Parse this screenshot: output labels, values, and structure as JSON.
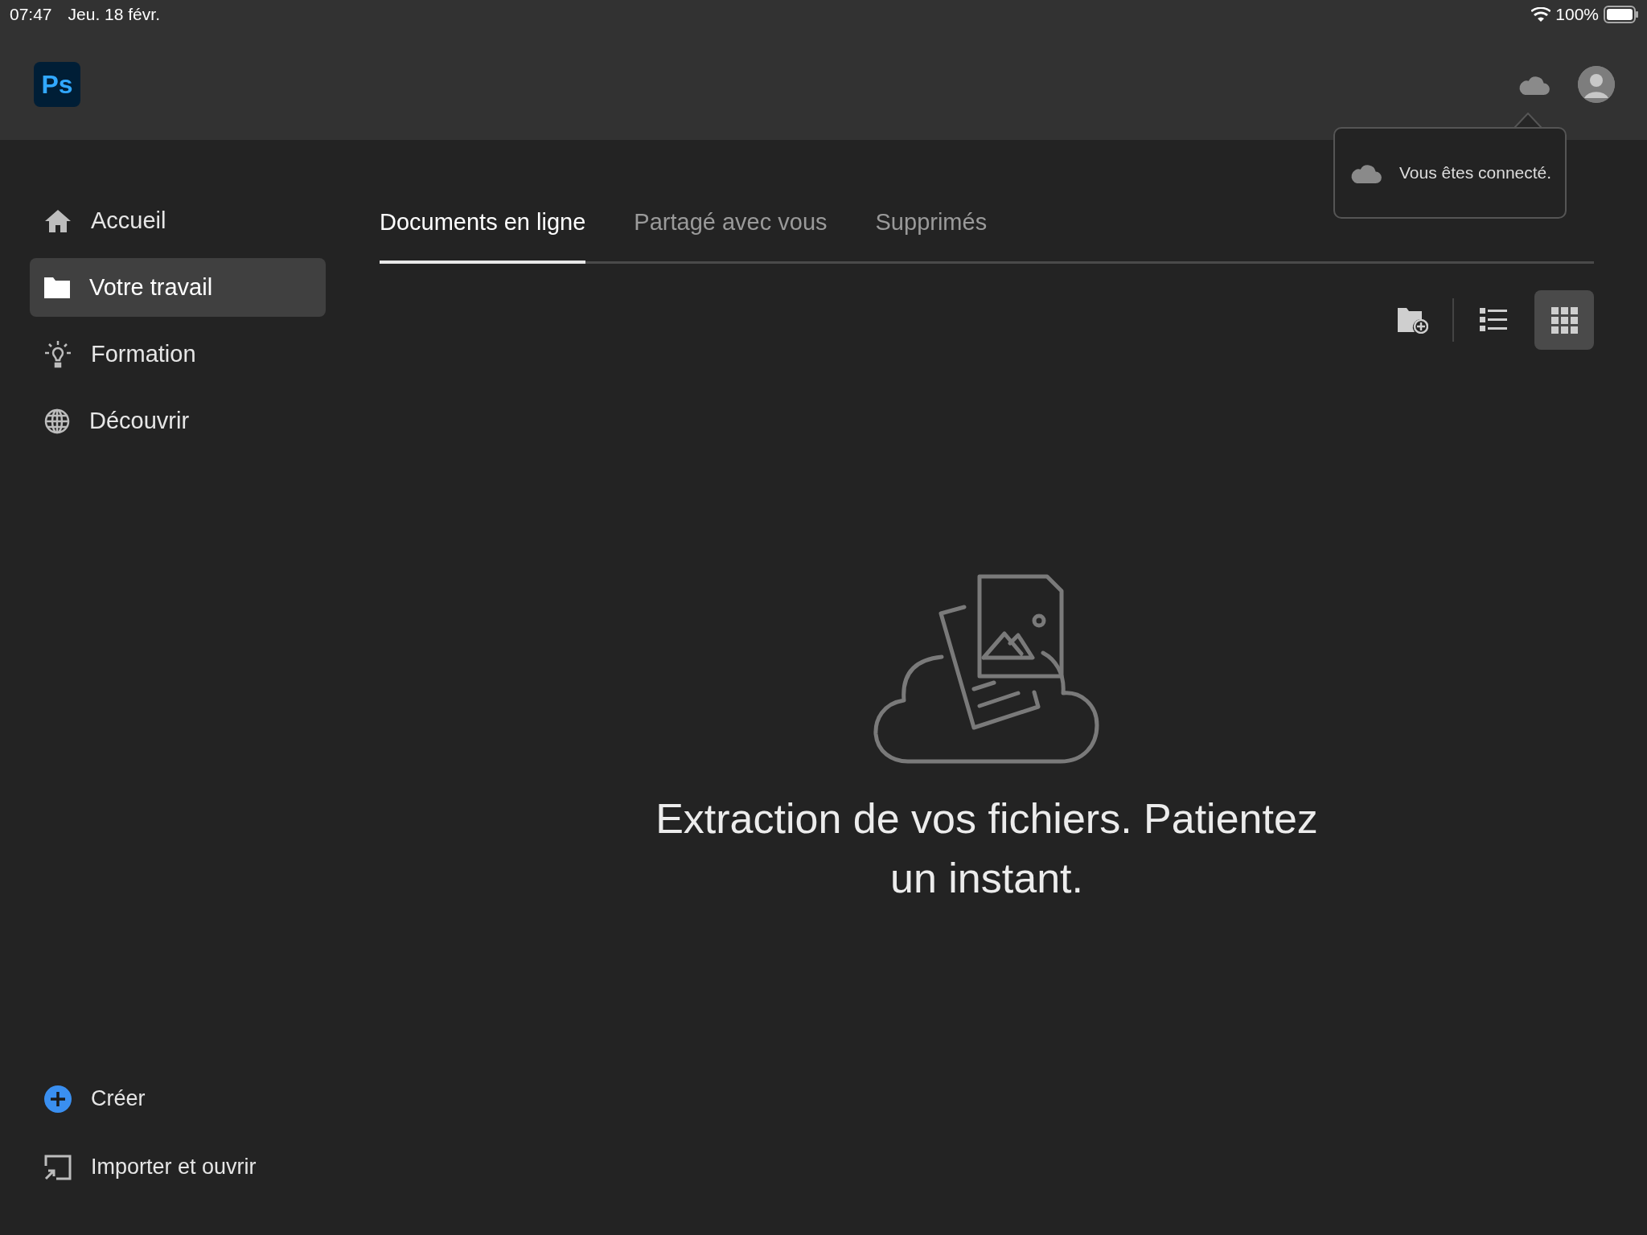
{
  "status_bar": {
    "time": "07:47",
    "date": "Jeu. 18 févr.",
    "battery": "100%"
  },
  "header": {
    "logo": "Ps"
  },
  "tooltip": {
    "text": "Vous êtes connecté."
  },
  "sidebar": {
    "items": [
      {
        "label": "Accueil",
        "kind": "home",
        "selected": false
      },
      {
        "label": "Votre travail",
        "kind": "folder",
        "selected": true
      },
      {
        "label": "Formation",
        "kind": "bulb",
        "selected": false
      },
      {
        "label": "Découvrir",
        "kind": "globe",
        "selected": false
      }
    ],
    "actions": [
      {
        "label": "Créer",
        "kind": "create"
      },
      {
        "label": "Importer et ouvrir",
        "kind": "import"
      }
    ]
  },
  "tabs": [
    {
      "label": "Documents en ligne",
      "selected": true
    },
    {
      "label": "Partagé avec vous",
      "selected": false
    },
    {
      "label": "Supprimés",
      "selected": false
    }
  ],
  "view_options": [
    {
      "kind": "list",
      "selected": false
    },
    {
      "kind": "grid",
      "selected": true
    }
  ],
  "message": "Extraction de vos fichiers. Patientez un instant."
}
